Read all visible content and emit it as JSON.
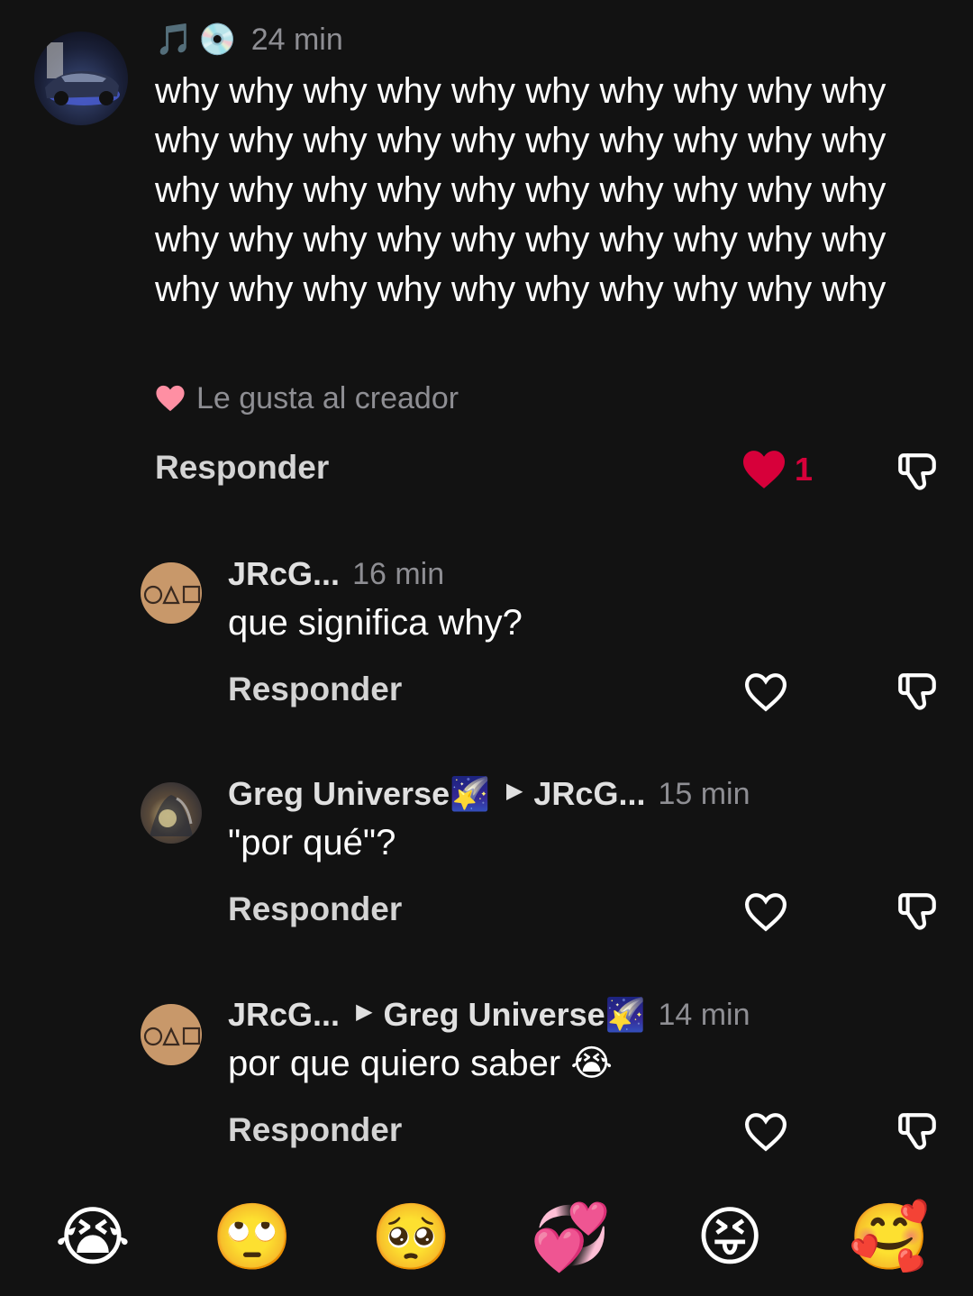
{
  "main_comment": {
    "badges": [
      "🎵",
      "💿"
    ],
    "time": "24 min",
    "text": "why why why why why why why why why why why why why why why why why why why why why why why why why why why why why why why why why why why why why why why why why why why why why why why why why why",
    "liked_by_creator": "Le gusta al creador",
    "reply_label": "Responder",
    "like_count": "1",
    "like_color": "#d7003a"
  },
  "replies": [
    {
      "username": "JRcG...",
      "reply_to": "",
      "time": "16 min",
      "text": "que significa why?",
      "reply_label": "Responder"
    },
    {
      "username": "Greg Universe🌠",
      "reply_to": "JRcG...",
      "time": "15 min",
      "text": "\"por qué\"?",
      "reply_label": "Responder"
    },
    {
      "username": "JRcG...",
      "reply_to": "Greg Universe🌠",
      "time": "14 min",
      "text": "por que quiero saber 😭",
      "reply_label": "Responder"
    }
  ],
  "emoji_bar": [
    "😭",
    "🙄",
    "🥺",
    "💞",
    "😝",
    "🥰"
  ],
  "colors": {
    "background": "#121212",
    "muted": "#8e8e93",
    "heart_filled": "#d7003a",
    "creator_heart": "#ff8fa3"
  },
  "icons": {
    "like": "heart-outline-icon",
    "dislike": "thumbs-down-icon",
    "liked": "heart-filled-icon"
  }
}
